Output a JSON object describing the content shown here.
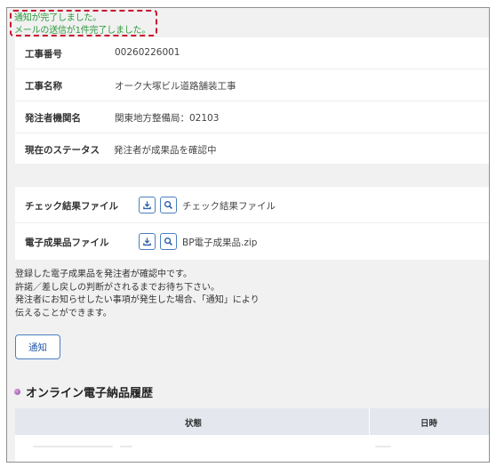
{
  "notice": {
    "line1": "通知が完了しました。",
    "line2": "メールの送信が1件完了しました。",
    "color": "#2d9a3c",
    "border_color": "#c8102e"
  },
  "info": {
    "rows": [
      {
        "label": "工事番号",
        "value": "00260226001"
      },
      {
        "label": "工事名称",
        "value": "オーク大塚ビル道路舗装工事"
      },
      {
        "label": "発注者機関名",
        "value": "関東地方整備局：02103"
      },
      {
        "label": "現在のステータス",
        "value": "発注者が成果品を確認中"
      }
    ]
  },
  "files": {
    "rows": [
      {
        "label": "チェック結果ファイル",
        "file": "チェック結果ファイル",
        "download_icon": "download-icon",
        "preview_icon": "search-icon"
      },
      {
        "label": "電子成果品ファイル",
        "file": "BP電子成果品.zip",
        "download_icon": "download-icon",
        "preview_icon": "search-icon"
      }
    ]
  },
  "message": {
    "lines": [
      "登録した電子成果品を発注者が確認中です。",
      "許諾／差し戻しの判断がされるまでお待ち下さい。",
      "発注者にお知らせしたい事項が発生した場合、「通知」により",
      "伝えることができます。"
    ]
  },
  "notify_button": {
    "label": "通知"
  },
  "history": {
    "title": "オンライン電子納品履歴",
    "columns": [
      "状態",
      "日時"
    ]
  },
  "colors": {
    "accent": "#4a7fc1",
    "panel_bg": "#ffffff",
    "page_bg": "#f1f1f1",
    "table_header_bg": "#e4e8ee"
  }
}
